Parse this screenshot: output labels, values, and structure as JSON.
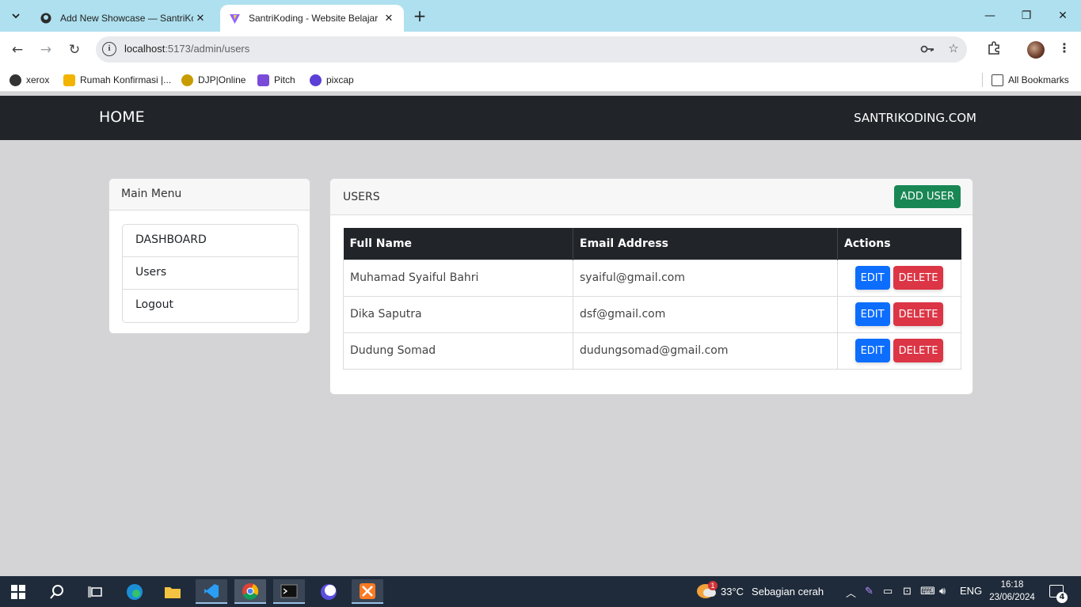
{
  "browser": {
    "tabs": [
      {
        "title": "Add New Showcase — SantriKo",
        "icon": "github-icon"
      },
      {
        "title": "SantriKoding - Website Belajar",
        "icon": "vite-icon"
      }
    ],
    "url_host": "localhost",
    "url_path": ":5173/admin/users",
    "bookmarks": [
      {
        "label": "xerox",
        "color": "#333333"
      },
      {
        "label": "Rumah Konfirmasi |...",
        "color": "#f2b400"
      },
      {
        "label": "DJP|Online",
        "color": "#c89b00"
      },
      {
        "label": "Pitch",
        "color": "#7a4bd9"
      },
      {
        "label": "pixcap",
        "color": "#5b3fd6"
      }
    ],
    "all_bookmarks": "All Bookmarks"
  },
  "navbar": {
    "home": "HOME",
    "site": "SANTRIKODING.COM"
  },
  "menu": {
    "title": "Main Menu",
    "items": [
      "DASHBOARD",
      "Users",
      "Logout"
    ]
  },
  "users": {
    "title": "USERS",
    "add_button": "ADD USER",
    "columns": [
      "Full Name",
      "Email Address",
      "Actions"
    ],
    "rows": [
      {
        "name": "Muhamad Syaiful Bahri",
        "email": "syaiful@gmail.com"
      },
      {
        "name": "Dika Saputra",
        "email": "dsf@gmail.com"
      },
      {
        "name": "Dudung Somad",
        "email": "dudungsomad@gmail.com"
      }
    ],
    "edit_label": "EDIT",
    "delete_label": "DELETE"
  },
  "taskbar": {
    "weather_temp": "33°C",
    "weather_desc": "Sebagian cerah",
    "weather_badge": "1",
    "language": "ENG",
    "time": "16:18",
    "date": "23/06/2024",
    "notification_count": "4"
  },
  "colors": {
    "navbar": "#212529",
    "add": "#198754",
    "edit": "#0d6efd",
    "delete": "#dc3545"
  }
}
